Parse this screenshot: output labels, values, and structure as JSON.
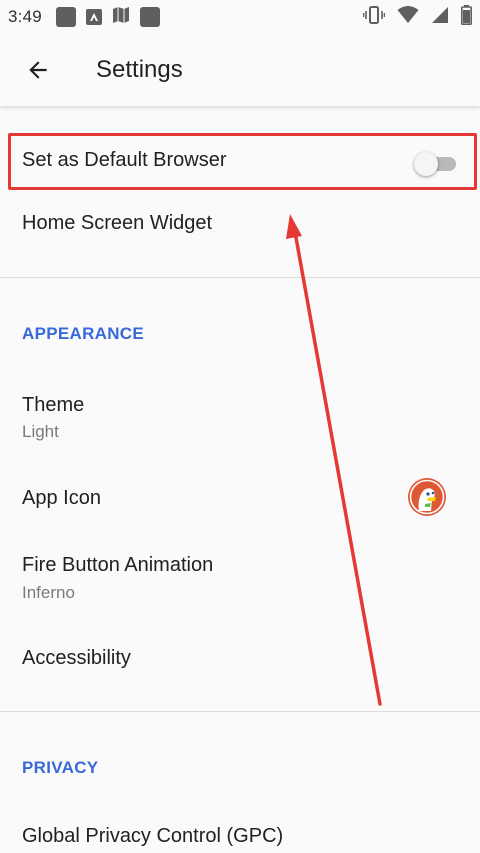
{
  "status_bar": {
    "time": "3:49",
    "left_icons": [
      "app-icon-1",
      "app-icon-2",
      "map-icon",
      "app-icon-3"
    ],
    "right_icons": [
      "vibrate-icon",
      "wifi-icon",
      "signal-icon",
      "battery-icon"
    ]
  },
  "app_bar": {
    "back_icon": "arrow-left-icon",
    "title": "Settings"
  },
  "settings": {
    "default_browser": {
      "title": "Set as Default Browser",
      "enabled": false
    },
    "home_widget": {
      "title": "Home Screen Widget"
    },
    "appearance_header": "APPEARANCE",
    "theme": {
      "title": "Theme",
      "value": "Light"
    },
    "app_icon": {
      "title": "App Icon",
      "icon": "duckduckgo-logo"
    },
    "fire_animation": {
      "title": "Fire Button Animation",
      "value": "Inferno"
    },
    "accessibility": {
      "title": "Accessibility"
    },
    "privacy_header": "PRIVACY",
    "gpc": {
      "title": "Global Privacy Control (GPC)"
    }
  },
  "colors": {
    "accent": "#3969d9",
    "highlight": "#e53935",
    "background": "#fafafa"
  }
}
